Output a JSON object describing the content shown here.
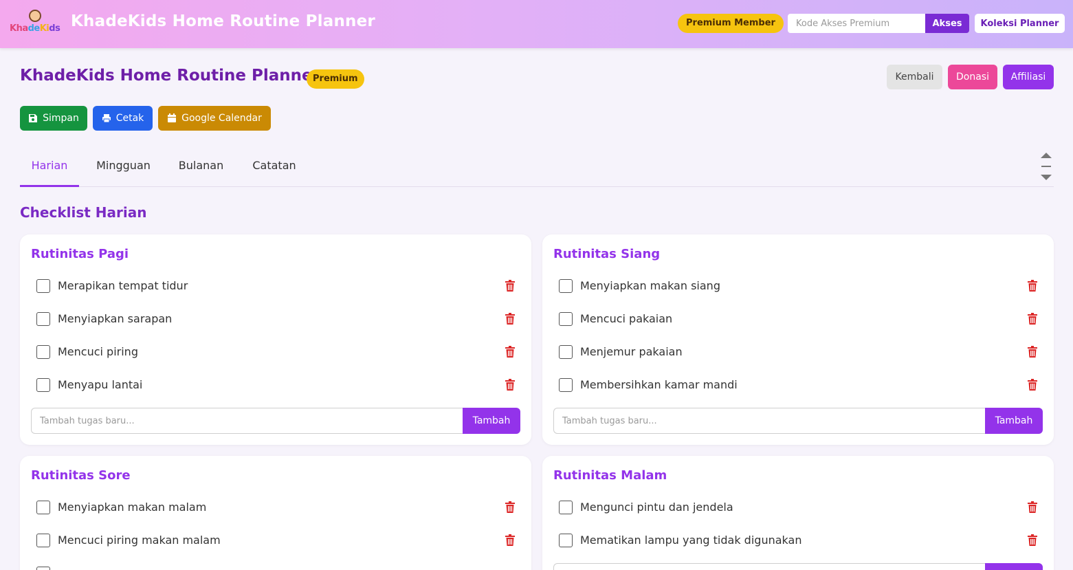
{
  "topbar": {
    "logo_text": "KhadeKids",
    "title": "KhadeKids Home Routine Planner",
    "premium_status": "Premium Member",
    "access_placeholder": "Kode Akses Premium",
    "access_button": "Akses",
    "collection_button": "Koleksi Planner"
  },
  "header": {
    "title": "KhadeKids Home Routine Planner",
    "badge": "Premium",
    "back_button": "Kembali",
    "donate_button": "Donasi",
    "affiliate_button": "Affiliasi"
  },
  "actions": {
    "save": "Simpan",
    "print": "Cetak",
    "calendar": "Google Calendar"
  },
  "tabs": [
    "Harian",
    "Mingguan",
    "Bulanan",
    "Catatan"
  ],
  "active_tab": "Harian",
  "section_title": "Checklist Harian",
  "add_placeholder": "Tambah tugas baru...",
  "add_button": "Tambah",
  "routines": [
    {
      "title": "Rutinitas Pagi",
      "tasks": [
        "Merapikan tempat tidur",
        "Menyiapkan sarapan",
        "Mencuci piring",
        "Menyapu lantai"
      ]
    },
    {
      "title": "Rutinitas Siang",
      "tasks": [
        "Menyiapkan makan siang",
        "Mencuci pakaian",
        "Menjemur pakaian",
        "Membersihkan kamar mandi"
      ]
    },
    {
      "title": "Rutinitas Sore",
      "tasks": [
        "Menyiapkan makan malam",
        "Mencuci piring makan malam"
      ]
    },
    {
      "title": "Rutinitas Malam",
      "tasks": [
        "Mengunci pintu dan jendela",
        "Mematikan lampu yang tidak digunakan"
      ]
    }
  ],
  "colors": {
    "accent": "#9333ea",
    "title_purple": "#6e1fa8",
    "premium_yellow": "#f6c40f",
    "save_green": "#15943f",
    "print_blue": "#2563eb",
    "calendar_gold": "#ca8a04",
    "donate_pink": "#ec4899",
    "delete_red": "#dc2626"
  }
}
